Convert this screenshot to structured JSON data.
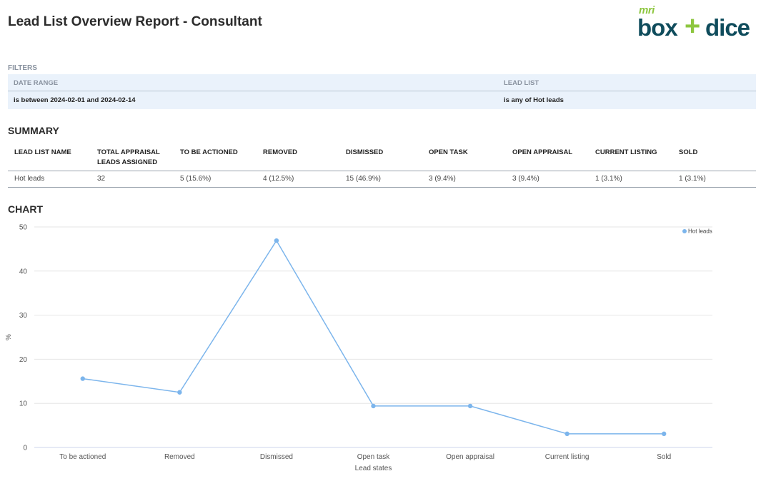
{
  "report": {
    "title": "Lead List Overview Report - Consultant"
  },
  "logo": {
    "mri": "mri",
    "box": "box",
    "plus": "+",
    "dice": "dice"
  },
  "filters": {
    "label": "FILTERS",
    "date_range": {
      "header": "DATE RANGE",
      "value": "is between 2024-02-01 and 2024-02-14"
    },
    "lead_list": {
      "header": "LEAD LIST",
      "value": "is any of Hot leads"
    }
  },
  "summary": {
    "heading": "SUMMARY",
    "columns": [
      {
        "line1": "LEAD LIST NAME",
        "line2": ""
      },
      {
        "line1": "TOTAL APPRAISAL",
        "line2": "LEADS ASSIGNED"
      },
      {
        "line1": "TO BE ACTIONED",
        "line2": ""
      },
      {
        "line1": "REMOVED",
        "line2": ""
      },
      {
        "line1": "DISMISSED",
        "line2": ""
      },
      {
        "line1": "OPEN TASK",
        "line2": ""
      },
      {
        "line1": "OPEN APPRAISAL",
        "line2": ""
      },
      {
        "line1": "CURRENT LISTING",
        "line2": ""
      },
      {
        "line1": "SOLD",
        "line2": ""
      }
    ],
    "row": [
      "Hot leads",
      "32",
      "5 (15.6%)",
      "4 (12.5%)",
      "15 (46.9%)",
      "3 (9.4%)",
      "3 (9.4%)",
      "1 (3.1%)",
      "1 (3.1%)"
    ]
  },
  "chart": {
    "heading": "CHART"
  },
  "chart_data": {
    "type": "line",
    "categories": [
      "To be actioned",
      "Removed",
      "Dismissed",
      "Open task",
      "Open appraisal",
      "Current listing",
      "Sold"
    ],
    "series": [
      {
        "name": "Hot leads",
        "values": [
          15.6,
          12.5,
          46.9,
          9.4,
          9.4,
          3.1,
          3.1
        ],
        "color": "#7cb5ec"
      }
    ],
    "xlabel": "Lead states",
    "ylabel": "%",
    "ylim": [
      0,
      50
    ],
    "yticks": [
      0,
      10,
      20,
      30,
      40,
      50
    ],
    "grid": true,
    "legend": "top-right"
  }
}
